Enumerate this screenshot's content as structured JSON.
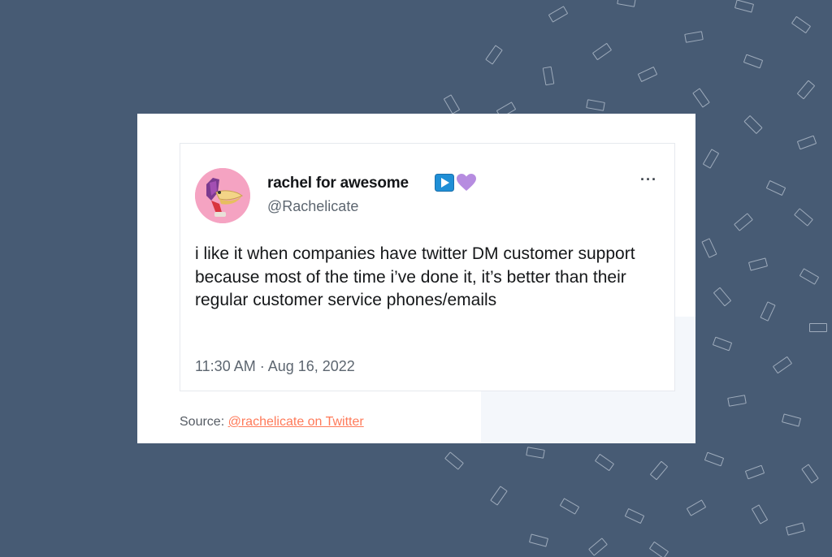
{
  "tweet": {
    "display_name": "rachel for awesome",
    "handle": "@Rachelicate",
    "more_label": "···",
    "text": "i like it when companies have twitter DM customer support because most of the time i’ve done it, it’s better than their regular customer service phones/emails",
    "timestamp": "11:30 AM · Aug 16, 2022"
  },
  "source": {
    "label": "Source:",
    "link_text": "@rachelicate on Twitter"
  },
  "colors": {
    "background": "#475b74",
    "link": "#ff7a59",
    "play_badge": "#1f8fd6",
    "heart_badge": "#b68ce0"
  },
  "icons": {
    "play_badge": "play-button-emoji-icon",
    "heart_badge": "purple-heart-emoji-icon",
    "more": "more-options-icon"
  }
}
